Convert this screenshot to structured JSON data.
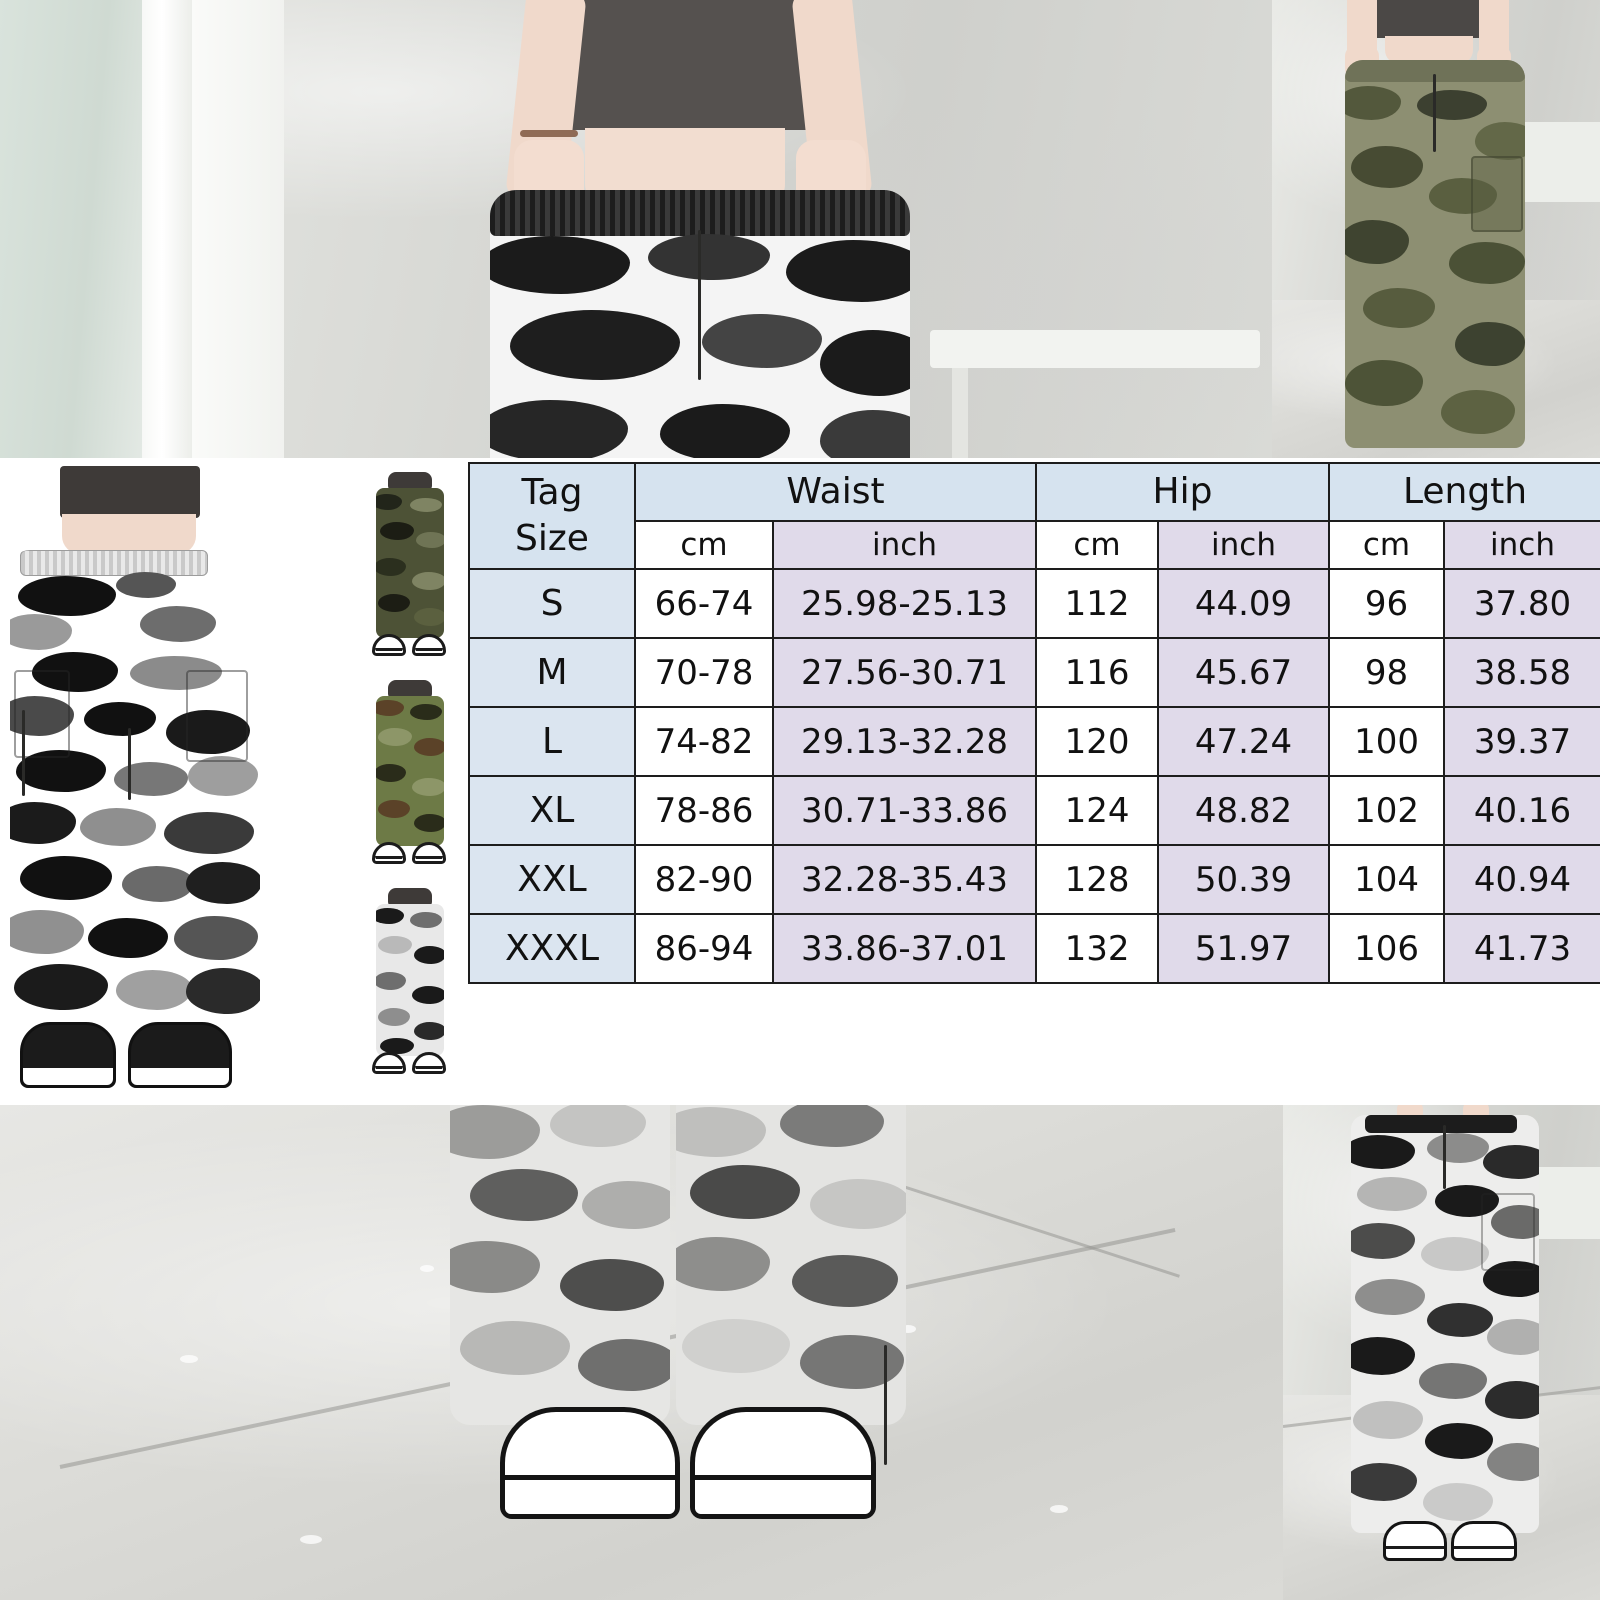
{
  "size_table": {
    "columns": [
      {
        "group": "Tag Size",
        "unit": ""
      },
      {
        "group": "Waist",
        "unit": "cm"
      },
      {
        "group": "Waist",
        "unit": "inch"
      },
      {
        "group": "Hip",
        "unit": "cm"
      },
      {
        "group": "Hip",
        "unit": "inch"
      },
      {
        "group": "Length",
        "unit": "cm"
      },
      {
        "group": "Length",
        "unit": "inch"
      }
    ],
    "tag_size_label_line1": "Tag",
    "tag_size_label_line2": "Size",
    "group_headers": [
      "Waist",
      "Hip",
      "Length"
    ],
    "unit_headers": [
      "cm",
      "inch",
      "cm",
      "inch",
      "cm",
      "inch"
    ],
    "rows": [
      {
        "size": "S",
        "waist_cm": "66-74",
        "waist_inch": "25.98-25.13",
        "hip_cm": "112",
        "hip_inch": "44.09",
        "length_cm": "96",
        "length_inch": "37.80"
      },
      {
        "size": "M",
        "waist_cm": "70-78",
        "waist_inch": "27.56-30.71",
        "hip_cm": "116",
        "hip_inch": "45.67",
        "length_cm": "98",
        "length_inch": "38.58"
      },
      {
        "size": "L",
        "waist_cm": "74-82",
        "waist_inch": "29.13-32.28",
        "hip_cm": "120",
        "hip_inch": "47.24",
        "length_cm": "100",
        "length_inch": "39.37"
      },
      {
        "size": "XL",
        "waist_cm": "78-86",
        "waist_inch": "30.71-33.86",
        "hip_cm": "124",
        "hip_inch": "48.82",
        "length_cm": "102",
        "length_inch": "40.16"
      },
      {
        "size": "XXL",
        "waist_cm": "82-90",
        "waist_inch": "32.28-35.43",
        "hip_cm": "128",
        "hip_inch": "50.39",
        "length_cm": "104",
        "length_inch": "40.94"
      },
      {
        "size": "XXXL",
        "waist_cm": "86-94",
        "waist_inch": "33.86-37.01",
        "hip_cm": "132",
        "hip_inch": "51.97",
        "length_cm": "106",
        "length_inch": "41.73"
      }
    ],
    "colors": {
      "header_blue": "#d6e3ef",
      "size_col_blue": "#dbe5f0",
      "inch_lavender": "#e0daea",
      "cm_white": "#ffffff",
      "border": "#1d1d1d"
    }
  },
  "photos": {
    "top_left": {
      "name": "model-indoor-grey-camo",
      "description": "Model in grey camo cargo pants and dark crop top, indoor concrete wall"
    },
    "top_right": {
      "name": "model-outdoor-green-camo",
      "description": "Model in green camo cargo pants standing outdoors"
    },
    "mid_left": {
      "name": "product-cutout-grey-camo",
      "description": "Product cutout of grey camo cargo pants on white background with black sneakers"
    },
    "variants": [
      {
        "name": "variant-dark-green-camo",
        "label": "",
        "colors": [
          "#4d5236",
          "#2b2f1e",
          "#7f8463",
          "#1c1d14"
        ]
      },
      {
        "name": "variant-woodland-camo",
        "label": "",
        "colors": [
          "#6d7a46",
          "#5b4228",
          "#2a2c1a",
          "#8d9668"
        ]
      },
      {
        "name": "variant-grey-white-camo",
        "label": "",
        "colors": [
          "#ffffff",
          "#b9b9b9",
          "#6e6e6e",
          "#1a1a1a"
        ]
      }
    ],
    "bottom_left": {
      "name": "pavement-shoes-closeup",
      "description": "Close-up of camo pant hems and white/black sneakers on pavement"
    },
    "bottom_right": {
      "name": "model-outdoor-grey-camo",
      "description": "Model in grey camo cargo pants outdoors on pavement"
    }
  }
}
